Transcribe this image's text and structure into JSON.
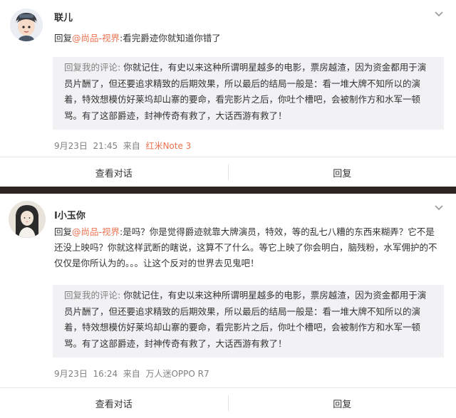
{
  "comments": [
    {
      "username": "联儿",
      "reply_prefix": "回复",
      "mention": "@尚品-视界",
      "reply_text": ":看完爵迹你就知道你错了",
      "quote_label": "回复我的评论:",
      "quote_text": " 你就记住，有史以来这种所谓明星越多的电影，票房越渣，因为资金都用于演员片酬了，但还要追求精致的后期效果，所以最后的结局一般是：看一堆大牌不知所以的演着，特效想模仿好莱坞却山寨的要命，看完影片之后，你吐个槽吧，会被制作方和水军一顿骂。有了这部爵迹，封神传奇有救了，大话西游有救了！",
      "date": "9月23日",
      "time": "21:45",
      "from": "来自",
      "source": "红米Note 3",
      "view_dialog": "查看对话",
      "reply": "回复"
    },
    {
      "username": "I小玉你",
      "reply_prefix": "回复",
      "mention": "@尚品-视界",
      "reply_text": ":是吗？你是觉得爵迹就靠大牌演员，特效，等的乱七八糟的东西来糊弄？它不是还没上映吗？你就这样武断的瞎说，这算不了什么。等它上映了你会明白，脑残粉，水军佣护的不仅仅是你所认为的。。。让这个反对的世界去见鬼吧！",
      "quote_label": "回复我的评论:",
      "quote_text": " 你就记住，有史以来这种所谓明星越多的电影，票房越渣，因为资金都用于演员片酬了，但还要追求精致的后期效果，所以最后的结局一般是：看一堆大牌不知所以的演着，特效想模仿好莱坞却山寨的要命，看完影片之后，你吐个槽吧，会被制作方和水军一顿骂。有了这部爵迹，封神传奇有救了，大话西游有救了！",
      "date": "9月23日",
      "time": "16:24",
      "from": "来自",
      "source": "万人迷OPPO R7",
      "view_dialog": "查看对话",
      "reply": "回复"
    }
  ],
  "colors": {
    "mention": "#eb7350",
    "quote_bg": "#f2f2f5",
    "meta": "#808080"
  }
}
